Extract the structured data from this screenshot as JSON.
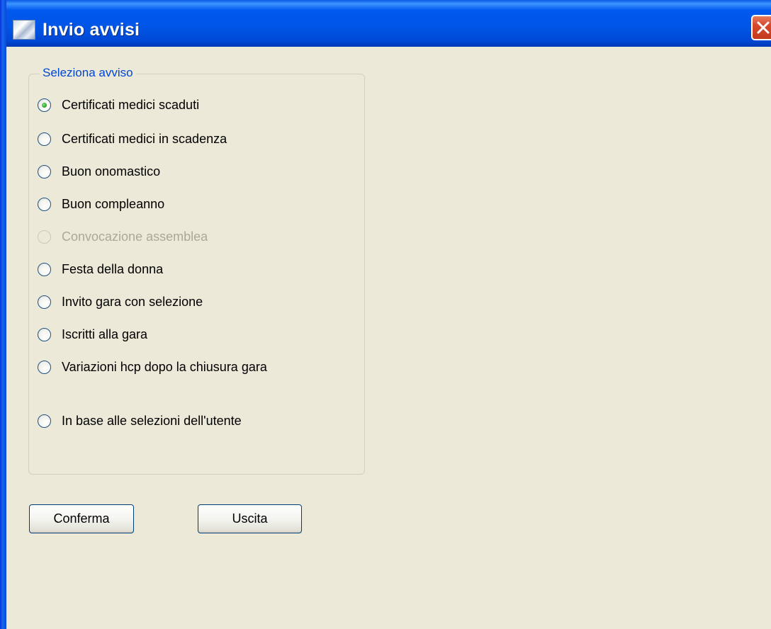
{
  "window": {
    "title": "Invio avvisi",
    "title_icon": "app-window-icon",
    "close_icon": "close-icon",
    "accent_color": "#0055e5",
    "close_color": "#d6482c"
  },
  "group": {
    "legend": "Seleziona avviso",
    "options": [
      {
        "label": "Certificati medici scaduti",
        "checked": true,
        "disabled": false
      },
      {
        "label": "Certificati medici in scadenza",
        "checked": false,
        "disabled": false
      },
      {
        "label": "Buon onomastico",
        "checked": false,
        "disabled": false
      },
      {
        "label": "Buon compleanno",
        "checked": false,
        "disabled": false
      },
      {
        "label": "Convocazione assemblea",
        "checked": false,
        "disabled": true
      },
      {
        "label": "Festa della donna",
        "checked": false,
        "disabled": false
      },
      {
        "label": "Invito gara con selezione",
        "checked": false,
        "disabled": false
      },
      {
        "label": "Iscritti alla gara",
        "checked": false,
        "disabled": false
      },
      {
        "label": "Variazioni hcp dopo la chiusura gara",
        "checked": false,
        "disabled": false
      },
      {
        "label": "In base alle selezioni dell'utente",
        "checked": false,
        "disabled": false
      }
    ]
  },
  "buttons": {
    "confirm_label": "Conferma",
    "exit_label": "Uscita"
  }
}
